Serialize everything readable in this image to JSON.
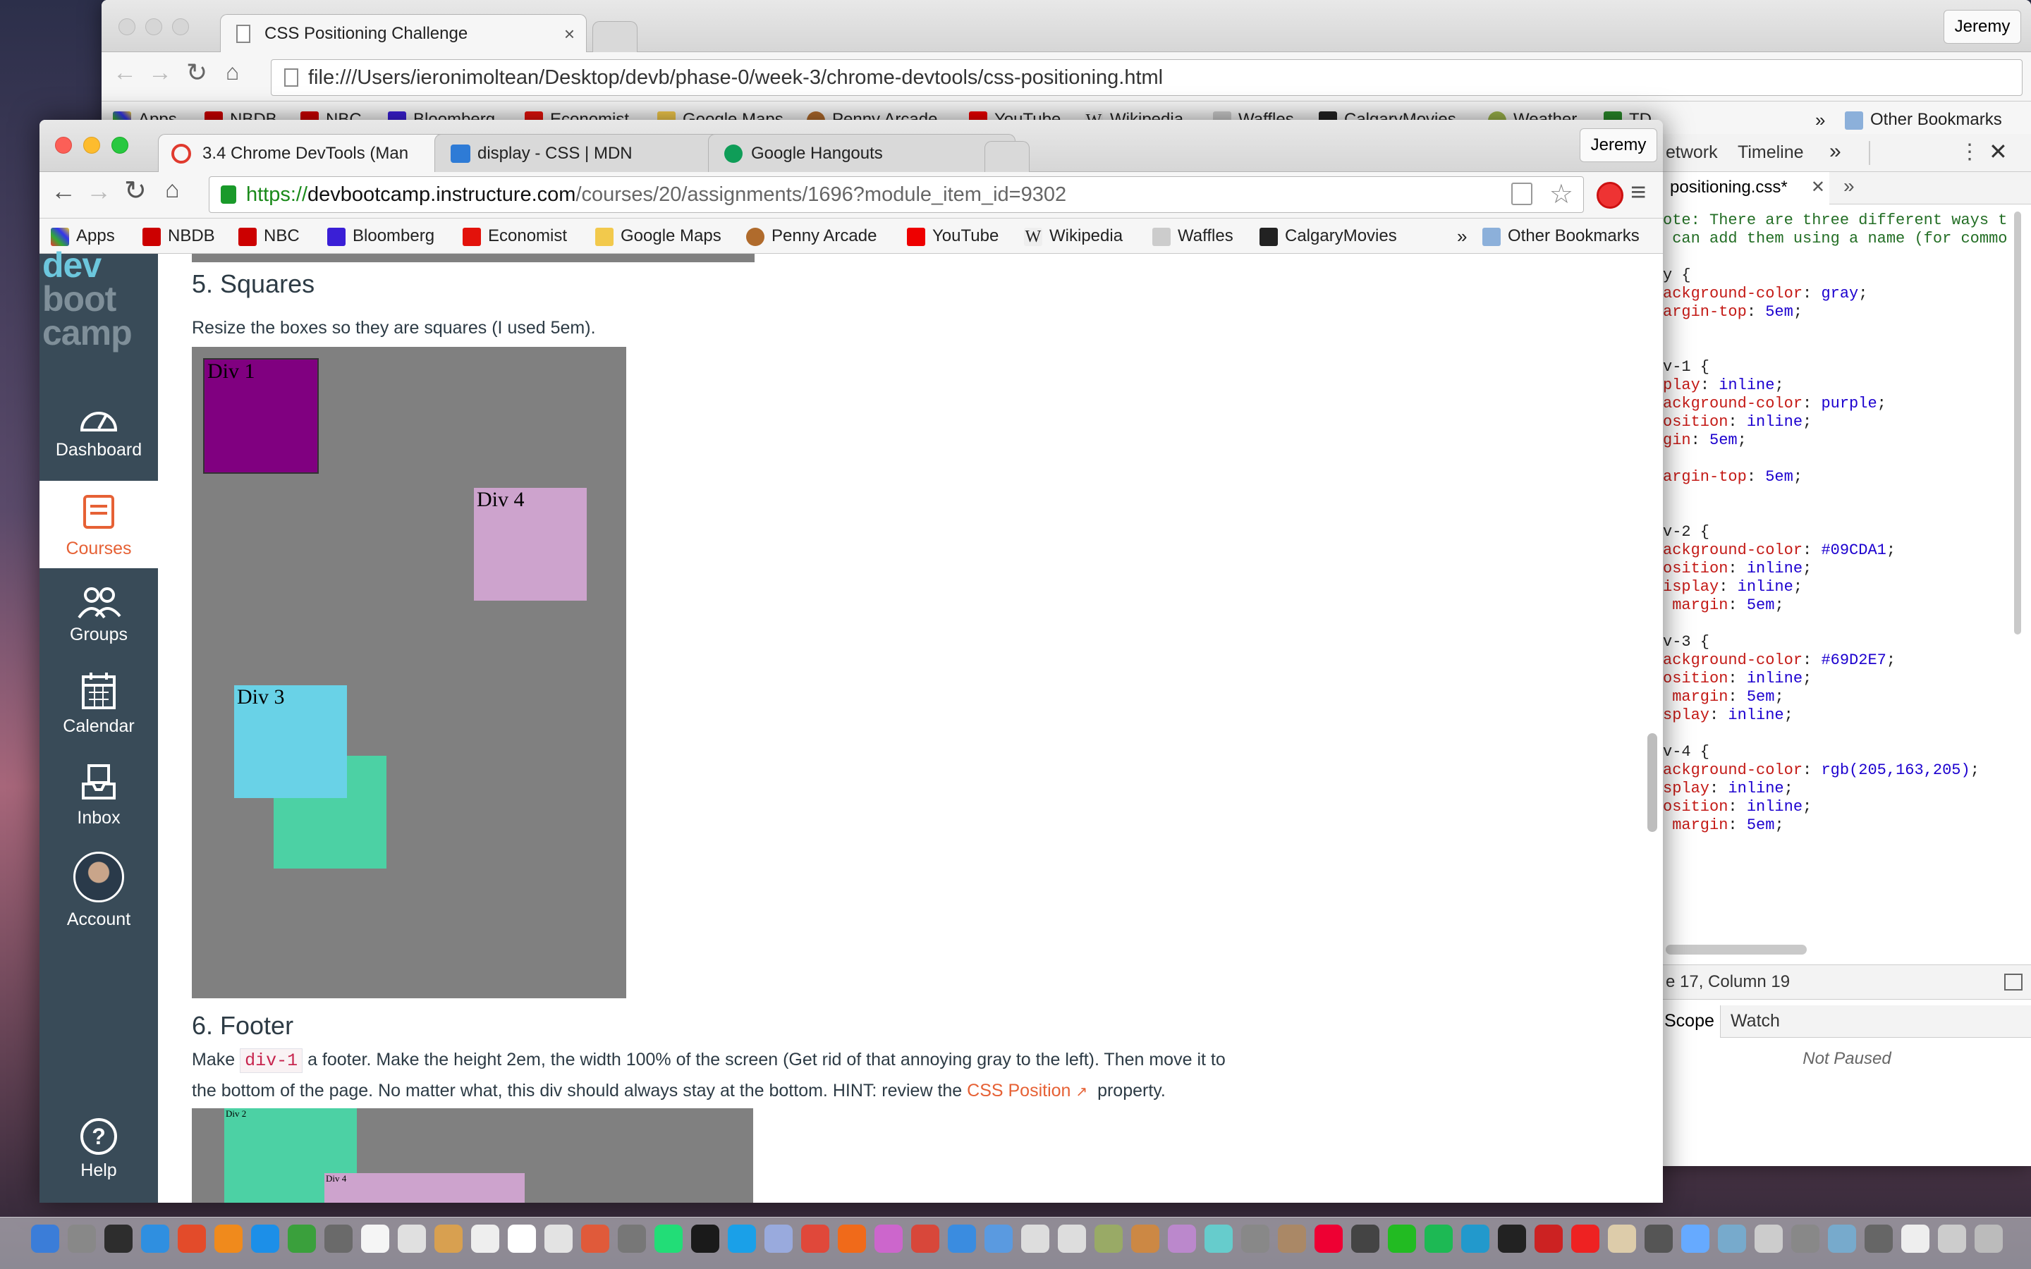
{
  "back_window": {
    "tab_title": "CSS Positioning Challenge",
    "user": "Jeremy",
    "url": "file:///Users/ieronimoltean/Desktop/devb/phase-0/week-3/chrome-devtools/css-positioning.html",
    "bookmarks": [
      "Apps",
      "NBDB",
      "NBC",
      "Bloomberg",
      "Economist",
      "Google Maps",
      "Penny Arcade",
      "YouTube",
      "Wikipedia",
      "Waffles",
      "CalgaryMovies",
      "Weather",
      "TD"
    ],
    "other_bookmarks": "Other Bookmarks"
  },
  "devtools": {
    "tabs": [
      "etwork",
      "Timeline"
    ],
    "more": "»",
    "file_tab": "positioning.css*",
    "code_lines": [
      [
        [
          "cm",
          "ote: There are three different ways t"
        ]
      ],
      [
        [
          "cm",
          " can add them using a name (for commo"
        ]
      ],
      [
        [
          "",
          ""
        ]
      ],
      [
        [
          "",
          "y {"
        ]
      ],
      [
        [
          "prop",
          "ackground-color"
        ],
        [
          "",
          ": "
        ],
        [
          "val",
          "gray"
        ],
        [
          "",
          ";"
        ]
      ],
      [
        [
          "prop",
          "argin-top"
        ],
        [
          "",
          ": "
        ],
        [
          "val",
          "5em"
        ],
        [
          "",
          ";"
        ]
      ],
      [
        [
          "",
          ""
        ]
      ],
      [
        [
          "",
          ""
        ]
      ],
      [
        [
          "",
          "v-1 {"
        ]
      ],
      [
        [
          "prop",
          "play"
        ],
        [
          "",
          ": "
        ],
        [
          "val",
          "inline"
        ],
        [
          "",
          ";"
        ]
      ],
      [
        [
          "prop",
          "ackground-color"
        ],
        [
          "",
          ": "
        ],
        [
          "val",
          "purple"
        ],
        [
          "",
          ";"
        ]
      ],
      [
        [
          "prop",
          "osition"
        ],
        [
          "",
          ": "
        ],
        [
          "val",
          "inline"
        ],
        [
          "",
          ";"
        ]
      ],
      [
        [
          "prop",
          "gin"
        ],
        [
          "",
          ": "
        ],
        [
          "val",
          "5em"
        ],
        [
          "",
          ";"
        ]
      ],
      [
        [
          "",
          ""
        ]
      ],
      [
        [
          "prop",
          "argin-top"
        ],
        [
          "",
          ": "
        ],
        [
          "val",
          "5em"
        ],
        [
          "",
          ";"
        ]
      ],
      [
        [
          "",
          ""
        ]
      ],
      [
        [
          "",
          ""
        ]
      ],
      [
        [
          "",
          "v-2 {"
        ]
      ],
      [
        [
          "prop",
          "ackground-color"
        ],
        [
          "",
          ": "
        ],
        [
          "val",
          "#09CDA1"
        ],
        [
          "",
          ";"
        ]
      ],
      [
        [
          "prop",
          "osition"
        ],
        [
          "",
          ": "
        ],
        [
          "val",
          "inline"
        ],
        [
          "",
          ";"
        ]
      ],
      [
        [
          "prop",
          "isplay"
        ],
        [
          "",
          ": "
        ],
        [
          "val",
          "inline"
        ],
        [
          "",
          ";"
        ]
      ],
      [
        [
          "prop",
          " margin"
        ],
        [
          "",
          ": "
        ],
        [
          "val",
          "5em"
        ],
        [
          "",
          ";"
        ]
      ],
      [
        [
          "",
          ""
        ]
      ],
      [
        [
          "",
          "v-3 {"
        ]
      ],
      [
        [
          "prop",
          "ackground-color"
        ],
        [
          "",
          ": "
        ],
        [
          "val",
          "#69D2E7"
        ],
        [
          "",
          ";"
        ]
      ],
      [
        [
          "prop",
          "osition"
        ],
        [
          "",
          ": "
        ],
        [
          "val",
          "inline"
        ],
        [
          "",
          ";"
        ]
      ],
      [
        [
          "prop",
          " margin"
        ],
        [
          "",
          ": "
        ],
        [
          "val",
          "5em"
        ],
        [
          "",
          ";"
        ]
      ],
      [
        [
          "prop",
          "splay"
        ],
        [
          "",
          ": "
        ],
        [
          "val",
          "inline"
        ],
        [
          "",
          ";"
        ]
      ],
      [
        [
          "",
          ""
        ]
      ],
      [
        [
          "",
          "v-4 {"
        ]
      ],
      [
        [
          "prop",
          "ackground-color"
        ],
        [
          "",
          ": "
        ],
        [
          "val",
          "rgb(205,163,205)"
        ],
        [
          "",
          ";"
        ]
      ],
      [
        [
          "prop",
          "splay"
        ],
        [
          "",
          ": "
        ],
        [
          "val",
          "inline"
        ],
        [
          "",
          ";"
        ]
      ],
      [
        [
          "prop",
          "osition"
        ],
        [
          "",
          ": "
        ],
        [
          "val",
          "inline"
        ],
        [
          "",
          ";"
        ]
      ],
      [
        [
          "prop",
          " margin"
        ],
        [
          "",
          ": "
        ],
        [
          "val",
          "5em"
        ],
        [
          "",
          ";"
        ]
      ]
    ],
    "status": "e 17, Column 19",
    "scope_tab": "Scope",
    "watch_tab": "Watch",
    "not_paused": "Not Paused"
  },
  "front_window": {
    "tabs": [
      {
        "title": "3.4 Chrome DevTools (Man"
      },
      {
        "title": "display - CSS | MDN"
      },
      {
        "title": "Google Hangouts"
      }
    ],
    "user": "Jeremy",
    "url_scheme": "https://",
    "url_host": "devbootcamp.instructure.com",
    "url_path": "/courses/20/assignments/1696?module_item_id=9302",
    "bookmarks": [
      "Apps",
      "NBDB",
      "NBC",
      "Bloomberg",
      "Economist",
      "Google Maps",
      "Penny Arcade",
      "YouTube",
      "Wikipedia",
      "Waffles",
      "CalgaryMovies"
    ],
    "other_bookmarks": "Other Bookmarks"
  },
  "canvas_nav": {
    "logo": [
      "dev",
      "boot",
      "camp"
    ],
    "items": [
      {
        "label": "Dashboard",
        "icon": "dashboard-icon"
      },
      {
        "label": "Courses",
        "icon": "courses-icon"
      },
      {
        "label": "Groups",
        "icon": "groups-icon"
      },
      {
        "label": "Calendar",
        "icon": "calendar-icon"
      },
      {
        "label": "Inbox",
        "icon": "inbox-icon"
      },
      {
        "label": "Account",
        "icon": "avatar"
      }
    ],
    "help": "Help",
    "help_glyph": "?"
  },
  "content": {
    "s5_title": "5. Squares",
    "s5_text": "Resize the boxes so they are squares (I used 5em).",
    "boxes": {
      "div1": "Div 1",
      "div4": "Div 4",
      "div3": "Div 3"
    },
    "s6_title": "6. Footer",
    "s6_make": "Make",
    "s6_code": "div-1",
    "s6_text_a": "a footer. Make the height 2em, the width 100% of the screen (Get rid of that annoying gray to the left). Then move it to",
    "s6_text_b": "the bottom of the page. No matter what, this div should always stay at the bottom. HINT: review the",
    "s6_link": "CSS Position",
    "s6_text_c": "property.",
    "mini": {
      "div2": "Div 2",
      "div4": "Div 4"
    },
    "colors": {
      "purple": "#800080",
      "lilac": "#cda3cd",
      "sky": "#69d2e7",
      "mint": "#4cd1a4",
      "gray": "#808080"
    }
  }
}
